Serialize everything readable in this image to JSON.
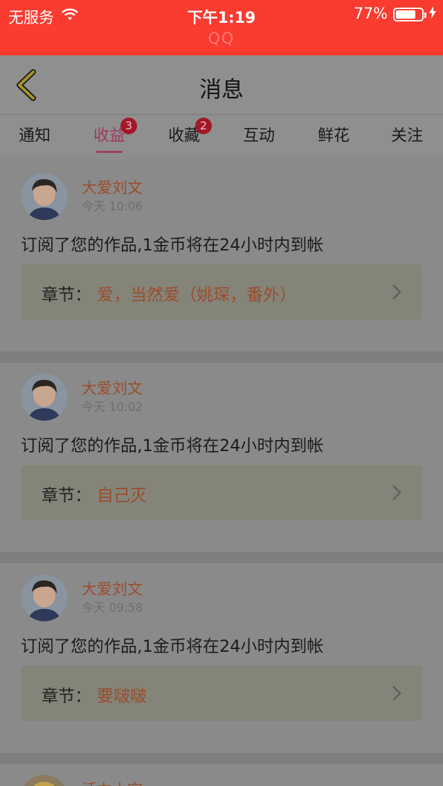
{
  "status_bar": {
    "carrier": "无服务",
    "time": "下午1:19",
    "battery_percent": "77%",
    "battery_level": 0.77,
    "subtitle": "QQ"
  },
  "nav": {
    "title": "消息"
  },
  "tabs": [
    {
      "label": "通知",
      "active": false,
      "badge": ""
    },
    {
      "label": "收益",
      "active": true,
      "badge": "3"
    },
    {
      "label": "收藏",
      "active": false,
      "badge": "2"
    },
    {
      "label": "互动",
      "active": false,
      "badge": ""
    },
    {
      "label": "鲜花",
      "active": false,
      "badge": ""
    },
    {
      "label": "关注",
      "active": false,
      "badge": ""
    }
  ],
  "messages": [
    {
      "user": "大爱刘文",
      "time": "今天 10:06",
      "text": "订阅了您的作品,1金币将在24小时内到帐",
      "chapter_label": "章节：",
      "chapter_title": "爱，当然爱（姚琛，番外）"
    },
    {
      "user": "大爱刘文",
      "time": "今天 10:02",
      "text": "订阅了您的作品,1金币将在24小时内到帐",
      "chapter_label": "章节：",
      "chapter_title": "自己灭"
    },
    {
      "user": "大爱刘文",
      "time": "今天 09:58",
      "text": "订阅了您的作品,1金币将在24小时内到帐",
      "chapter_label": "章节：",
      "chapter_title": "要啵啵"
    }
  ],
  "partial_message": {
    "user": "活力太空"
  },
  "colors": {
    "status_bar": "#f93b30",
    "accent": "#a03a5e",
    "badge": "#a3172a",
    "name": "#9a4d2c"
  }
}
